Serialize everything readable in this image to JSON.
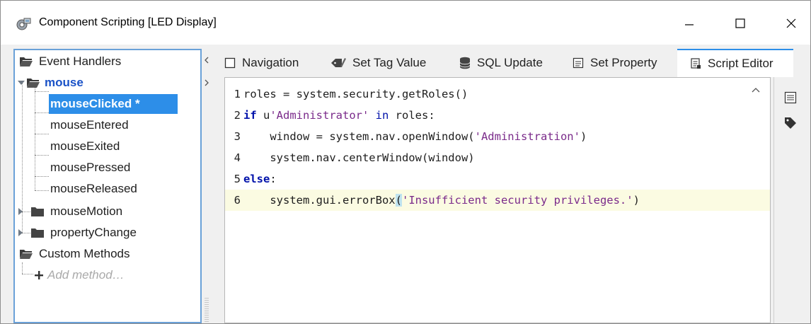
{
  "window": {
    "title": "Component Scripting [LED Display]",
    "controls": [
      "minimize",
      "maximize",
      "close"
    ]
  },
  "tree": {
    "event_handlers_label": "Event Handlers",
    "mouse_label": "mouse",
    "mouse_children": [
      "mouseClicked *",
      "mouseEntered",
      "mouseExited",
      "mousePressed",
      "mouseReleased"
    ],
    "mouse_motion_label": "mouseMotion",
    "property_change_label": "propertyChange",
    "custom_methods_label": "Custom Methods",
    "add_method_label": "Add method…",
    "selected": "mouseClicked *"
  },
  "tabs": [
    {
      "label": "Navigation",
      "icon": "checkbox-icon"
    },
    {
      "label": "Set Tag Value",
      "icon": "tag-pen-icon"
    },
    {
      "label": "SQL Update",
      "icon": "database-icon"
    },
    {
      "label": "Set Property",
      "icon": "property-icon"
    },
    {
      "label": "Script Editor",
      "icon": "script-icon",
      "active": true
    }
  ],
  "editor": {
    "lines": [
      {
        "n": "1",
        "parts": [
          [
            "plain",
            "roles = system.security.getRoles()"
          ]
        ]
      },
      {
        "n": "2",
        "parts": [
          [
            "kw",
            "if"
          ],
          [
            "plain",
            " u"
          ],
          [
            "str",
            "'Administrator'"
          ],
          [
            "plain",
            " "
          ],
          [
            "kwsoft",
            "in"
          ],
          [
            "plain",
            " roles:"
          ]
        ]
      },
      {
        "n": "3",
        "parts": [
          [
            "plain",
            "    window = system.nav.openWindow("
          ],
          [
            "str",
            "'Administration'"
          ],
          [
            "plain",
            ")"
          ]
        ]
      },
      {
        "n": "4",
        "parts": [
          [
            "plain",
            "    system.nav.centerWindow(window)"
          ]
        ]
      },
      {
        "n": "5",
        "parts": [
          [
            "kw",
            "else"
          ],
          [
            "plain",
            ":"
          ]
        ]
      },
      {
        "n": "6",
        "parts": [
          [
            "plain",
            "    system.gui.errorBox"
          ],
          [
            "hl",
            "("
          ],
          [
            "str",
            "'Insufficient security privileges.'"
          ],
          [
            "plain",
            ")"
          ]
        ],
        "current": true
      }
    ]
  },
  "side_tools": [
    "list-icon",
    "tag-icon"
  ],
  "colors": {
    "selection": "#2d8ee8",
    "keyword": "#0011aa",
    "string": "#7a2a8a",
    "current_line": "#fbfbe2",
    "tree_border": "#6aa1d8"
  }
}
